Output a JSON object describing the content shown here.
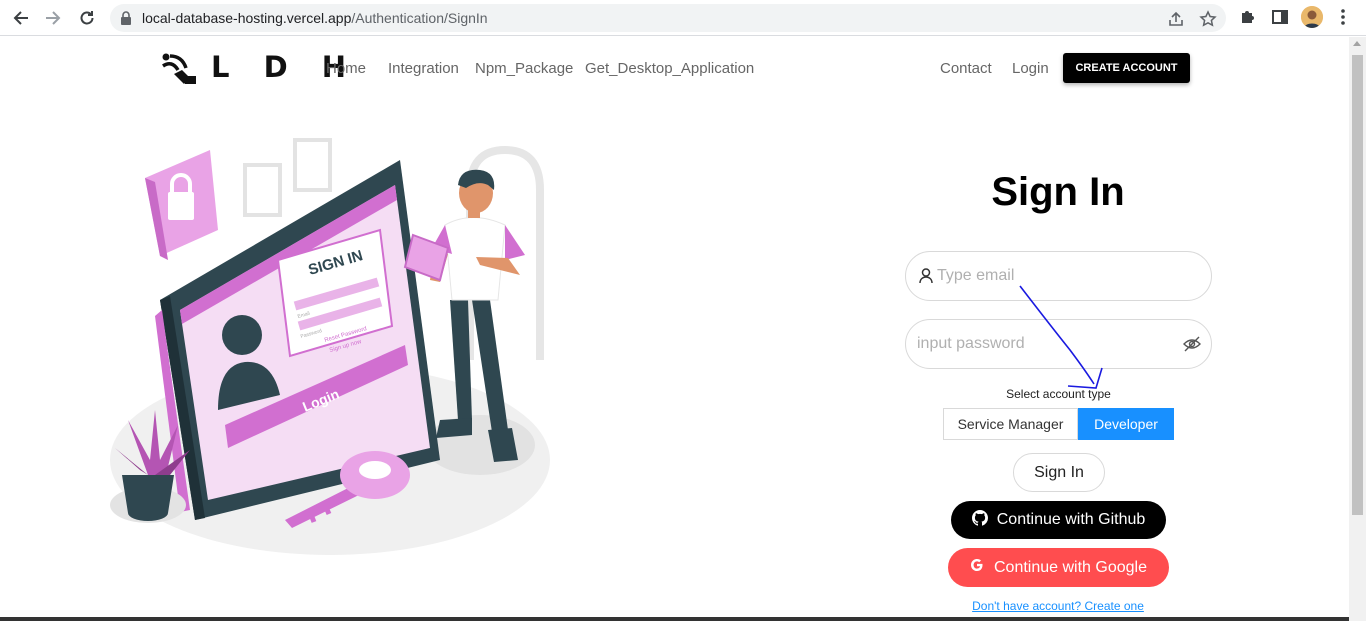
{
  "browser": {
    "url_host": "local-database-hosting.vercel.app",
    "url_path": "/Authentication/SignIn",
    "icons": [
      "back-arrow-icon",
      "forward-arrow-icon",
      "reload-icon",
      "lock-icon",
      "share-icon",
      "star-icon",
      "puzzle-icon",
      "side-panel-icon",
      "kebab-menu-icon"
    ]
  },
  "header": {
    "logo_text": "L D H",
    "nav": {
      "home": "Home",
      "integration": "Integration",
      "npm": "Npm_Package",
      "desktop": "Get_Desktop_Application",
      "contact": "Contact",
      "login": "Login"
    },
    "create_account": "CREATE ACCOUNT"
  },
  "illustration": {
    "screen_title": "SIGN IN",
    "email_hint": "Email",
    "password_hint": "Password",
    "reset_link": "Reset Password",
    "signup_link": "Sign up now",
    "login_button": "Login"
  },
  "form": {
    "title": "Sign In",
    "email_placeholder": "Type email",
    "password_placeholder": "input password",
    "account_type_label": "Select account type",
    "account_types": [
      "Service Manager",
      "Developer"
    ],
    "selected_account_type": "Developer",
    "signin_button": "Sign In",
    "github_button": "Continue with Github",
    "google_button": "Continue with Google",
    "create_link": "Don't have account? Create one"
  },
  "colors": {
    "accent_blue": "#1890ff",
    "google_red": "#ff4d4f",
    "black": "#000000",
    "illustration_pink": "#d16fd0"
  }
}
